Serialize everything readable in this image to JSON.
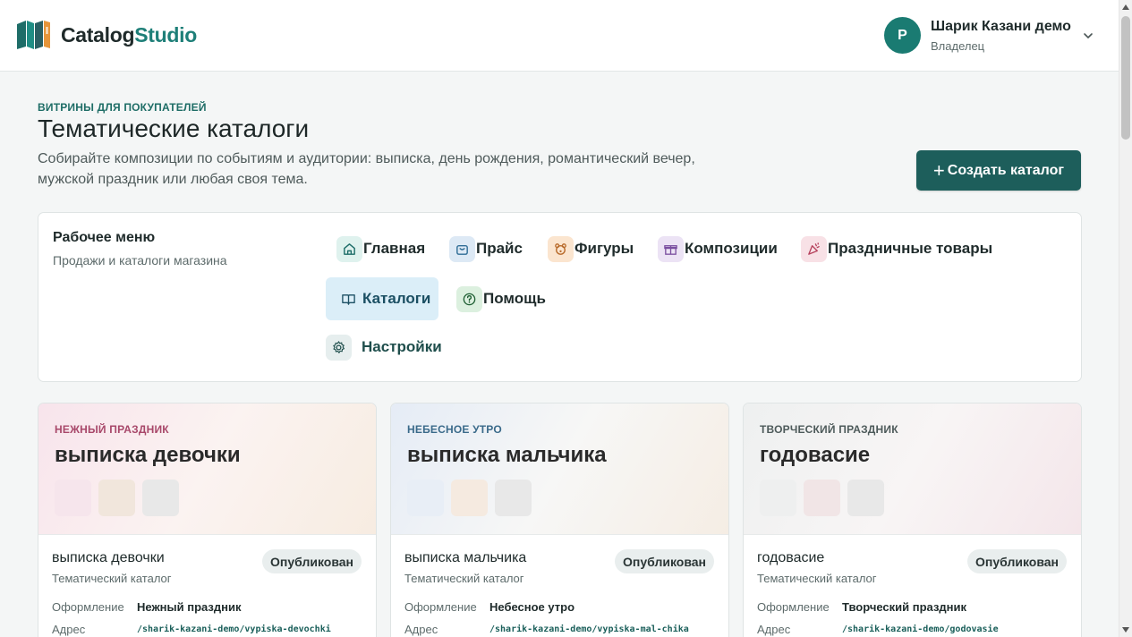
{
  "header": {
    "logo_part1": "Catalog",
    "logo_part2": "Studio",
    "user": {
      "initial": "Р",
      "name": "Шарик Казани демо",
      "role": "Владелец"
    }
  },
  "intro": {
    "eyebrow": "ВИТРИНЫ ДЛЯ ПОКУПАТЕЛЕЙ",
    "title": "Тематические каталоги",
    "description": "Собирайте композиции по событиям и аудитории: выписка, день рождения, романтический вечер, мужской праздник или любая своя тема.",
    "create_button": "Создать каталог"
  },
  "menu": {
    "title": "Рабочее меню",
    "subtitle": "Продажи и каталоги магазина",
    "items": [
      {
        "label": "Главная",
        "icon": "home-icon"
      },
      {
        "label": "Прайс",
        "icon": "shopping-bag-icon"
      },
      {
        "label": "Фигуры",
        "icon": "bear-icon"
      },
      {
        "label": "Композиции",
        "icon": "gift-icon"
      },
      {
        "label": "Праздничные товары",
        "icon": "party-popper-icon"
      },
      {
        "label": "Каталоги",
        "icon": "book-icon",
        "active": true
      },
      {
        "label": "Помощь",
        "icon": "help-circle-icon"
      },
      {
        "label": "Настройки",
        "icon": "gear-icon"
      }
    ]
  },
  "labels": {
    "design": "Оформление",
    "address": "Адрес"
  },
  "catalogs": [
    {
      "theme": "НЕЖНЫЙ ПРАЗДНИК",
      "theme_color": "#a8486a",
      "hero_title": "выписка девочки",
      "name": "выписка девочки",
      "type": "Тематический каталог",
      "status": "Опубликован",
      "design": "Нежный праздник",
      "address": "/sharik-kazani-demo/vypiska-devochki",
      "swatches": [
        "#f6e5ec",
        "#f1e6dc",
        "#e8e8e8"
      ]
    },
    {
      "theme": "НЕБЕСНОЕ УТРО",
      "theme_color": "#3a6a8a",
      "hero_title": "выписка мальчика",
      "name": "выписка мальчика",
      "type": "Тематический каталог",
      "status": "Опубликован",
      "design": "Небесное утро",
      "address": "/sharik-kazani-demo/vypiska-mal-chika",
      "swatches": [
        "#e8eef6",
        "#f5eae0",
        "#e8e8e8"
      ]
    },
    {
      "theme": "ТВОРЧЕСКИЙ ПРАЗДНИК",
      "theme_color": "#4d5a5a",
      "hero_title": "годовасие",
      "name": "годовасие",
      "type": "Тематический каталог",
      "status": "Опубликован",
      "design": "Творческий праздник",
      "address": "/sharik-kazani-demo/godovasie",
      "swatches": [
        "#eeefef",
        "#f1e5e6",
        "#e8e8e8"
      ]
    }
  ]
}
